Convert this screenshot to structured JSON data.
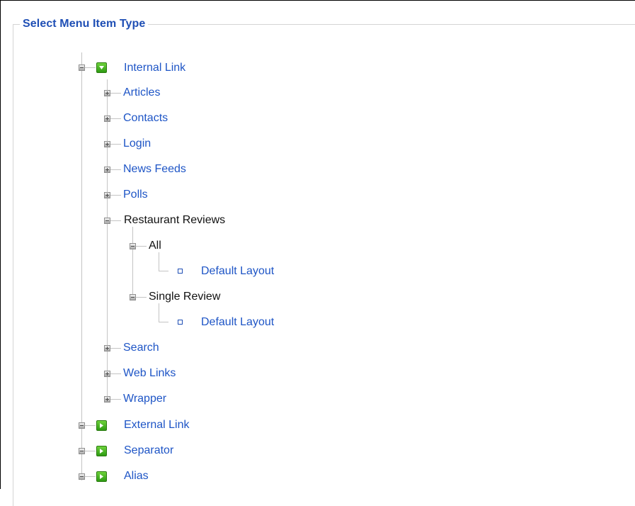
{
  "panel": {
    "legend": "Select Menu Item Type"
  },
  "tree": {
    "internal_link": "Internal Link",
    "children": {
      "articles": "Articles",
      "contacts": "Contacts",
      "login": "Login",
      "news_feeds": "News Feeds",
      "polls": "Polls",
      "restaurant_reviews": "Restaurant Reviews",
      "all": "All",
      "all_default_layout": "Default Layout",
      "single_review": "Single Review",
      "single_default_layout": "Default Layout",
      "search": "Search",
      "web_links": "Web Links",
      "wrapper": "Wrapper"
    },
    "external_link": "External Link",
    "separator": "Separator",
    "alias": "Alias"
  },
  "colors": {
    "link": "#1e55c6",
    "legend": "#1f4fb5",
    "expander_green": "#3aaa1a"
  },
  "icons": {
    "expander": "plus-minus-box-icon",
    "type_toggle": "green-arrow-box-icon",
    "leaf": "small-square-icon"
  }
}
